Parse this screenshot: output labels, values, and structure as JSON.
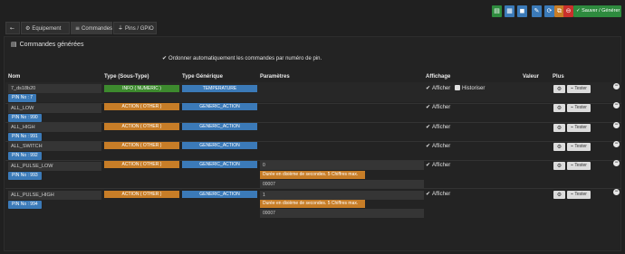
{
  "toolbar": {
    "buttons": [
      {
        "icon": "list-icon",
        "glyph": "▤",
        "color": "#2e8b3e"
      },
      {
        "icon": "docs-icon",
        "glyph": "▦",
        "color": "#3b7ab8"
      },
      {
        "icon": "save-icon",
        "glyph": "◼",
        "color": "#3b7ab8"
      },
      {
        "icon": "wrench-icon",
        "glyph": "✎",
        "color": "#3b7ab8"
      },
      {
        "icon": "refresh-icon",
        "glyph": "⟳",
        "color": "#3b7ab8"
      },
      {
        "icon": "copy-icon",
        "glyph": "⧉",
        "color": "#c77d27"
      },
      {
        "icon": "delete-icon",
        "glyph": "⊖",
        "color": "#c9302c"
      }
    ],
    "save_label": "Sauver / Générer",
    "save_glyph": "✓"
  },
  "tabs": [
    {
      "label": "",
      "icon": "back-arrow-icon",
      "glyph": "←"
    },
    {
      "label": "Equipement",
      "icon": "gears-icon",
      "glyph": "⚙"
    },
    {
      "label": "Commandes",
      "icon": "list-icon",
      "glyph": "≡"
    },
    {
      "label": "Pins / GPIO",
      "icon": "plug-icon",
      "glyph": "🔌"
    }
  ],
  "panel": {
    "title": "Commandes générées",
    "title_glyph": "▤",
    "note": "Ordonner automatiquement les commandes par numéro de pin.",
    "note_glyph": "✔"
  },
  "headers": {
    "nom": "Nom",
    "type": "Type (Sous-Type)",
    "generique": "Type Générique",
    "parametres": "Paramètres",
    "affichage": "Affichage",
    "valeur": "Valeur",
    "plus": "Plus"
  },
  "commands": [
    {
      "name": "7_ds18b20",
      "pin": "PIN No : 7",
      "type": "INFO ( NUMERIC )",
      "type_kind": "info",
      "generic": "TEMPERATURE",
      "param": "",
      "tooltip": "",
      "param2": "",
      "afficher": "Afficher",
      "historiser": "Historiser"
    },
    {
      "name": "ALL_LOW",
      "pin": "PIN No : 990",
      "type": "ACTION ( OTHER )",
      "type_kind": "action",
      "generic": "GENERIC_ACTION",
      "param": "",
      "tooltip": "",
      "param2": "",
      "afficher": "Afficher",
      "historiser": ""
    },
    {
      "name": "ALL_HIGH",
      "pin": "PIN No : 991",
      "type": "ACTION ( OTHER )",
      "type_kind": "action",
      "generic": "GENERIC_ACTION",
      "param": "",
      "tooltip": "",
      "param2": "",
      "afficher": "Afficher",
      "historiser": ""
    },
    {
      "name": "ALL_SWITCH",
      "pin": "PIN No : 992",
      "type": "ACTION ( OTHER )",
      "type_kind": "action",
      "generic": "GENERIC_ACTION",
      "param": "",
      "tooltip": "",
      "param2": "",
      "afficher": "Afficher",
      "historiser": ""
    },
    {
      "name": "ALL_PULSE_LOW",
      "pin": "PIN No : 993",
      "type": "ACTION ( OTHER )",
      "type_kind": "action",
      "generic": "GENERIC_ACTION",
      "param": "0",
      "tooltip": "Durée en dixième de secondes. 5 Chiffres max.",
      "param2": "00007",
      "afficher": "Afficher",
      "historiser": ""
    },
    {
      "name": "ALL_PULSE_HIGH",
      "pin": "PIN No : 994",
      "type": "ACTION ( OTHER )",
      "type_kind": "action",
      "generic": "GENERIC_ACTION",
      "param": "1",
      "tooltip": "Durée en dixième de secondes. 5 Chiffres max.",
      "param2": "00007",
      "afficher": "Afficher",
      "historiser": ""
    }
  ],
  "row_actions": {
    "gear_glyph": "⚙",
    "test_label": "Tester",
    "test_glyph": "⌁",
    "check_glyph": "✔",
    "remove_glyph": "−"
  }
}
